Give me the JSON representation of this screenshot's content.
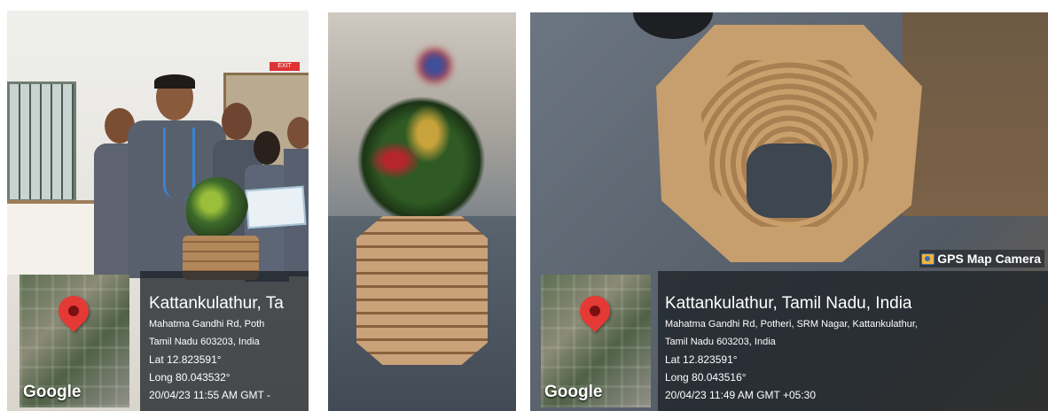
{
  "photos": [
    {
      "location": {
        "place": "Kattankulathur, Ta",
        "address_line1": "Mahatma Gandhi Rd, Poth",
        "address_line2": "Tamil Nadu 603203, India",
        "lat": "Lat 12.823591°",
        "long": "Long 80.043532°",
        "datetime": "20/04/23 11:55 AM GMT -"
      },
      "map_logo": "Google"
    },
    {
      "description": ""
    },
    {
      "badge": "GPS Map Camera",
      "location": {
        "place": "Kattankulathur, Tamil Nadu, India",
        "address_line1": "Mahatma Gandhi Rd, Potheri, SRM Nagar, Kattankulathur,",
        "address_line2": "Tamil Nadu 603203, India",
        "lat": "Lat 12.823591°",
        "long": "Long 80.043516°",
        "datetime": "20/04/23 11:49 AM GMT +05:30"
      },
      "map_logo": "Google"
    }
  ],
  "scene_signs": {
    "exit": "EXIT"
  },
  "colors": {
    "pin": "#e53935",
    "overlay": "rgba(30,34,40,0.78)"
  }
}
